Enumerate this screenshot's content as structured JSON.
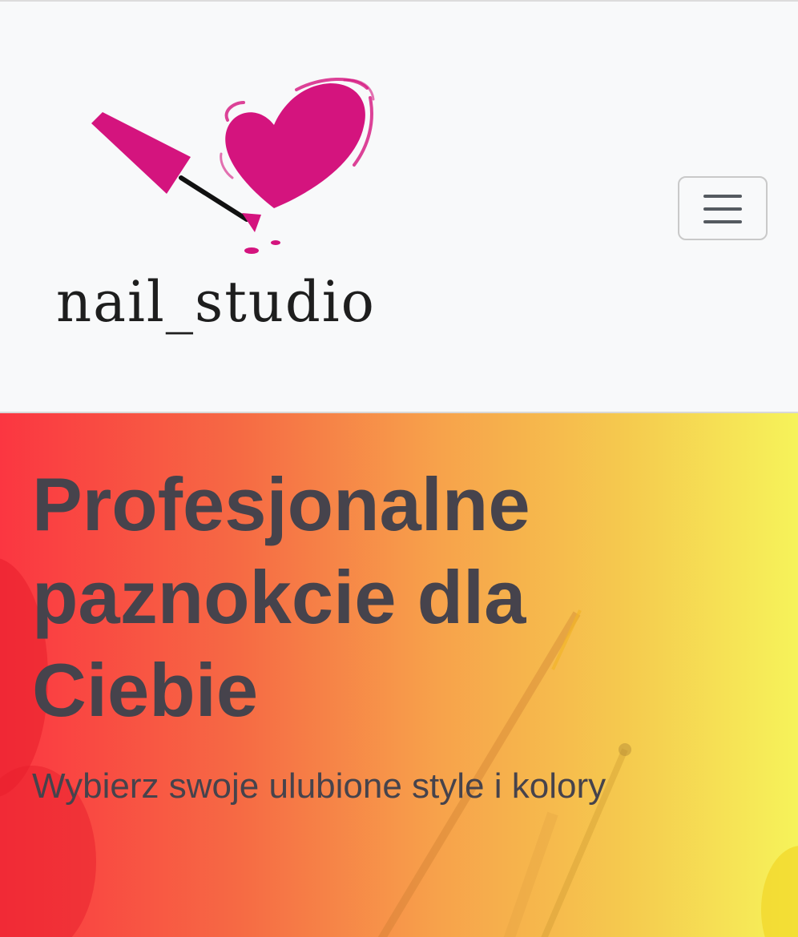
{
  "navbar": {
    "brand": {
      "text": "nail_studio",
      "colors": {
        "heart": "#d4147e",
        "brush": "#d4147e",
        "handle": "#111111"
      },
      "icon": "nail-polish-heart-logo"
    },
    "toggler": {
      "icon": "hamburger-menu-icon"
    }
  },
  "hero": {
    "title": "Profesjonalne paznokcie dla Ciebie",
    "subtitle": "Wybierz swoje ulubione style i kolory",
    "gradient": [
      "#fb3641",
      "#f66a44",
      "#f7a24b",
      "#f5c94e",
      "#f6f35a"
    ],
    "text_color": "#46434c"
  }
}
